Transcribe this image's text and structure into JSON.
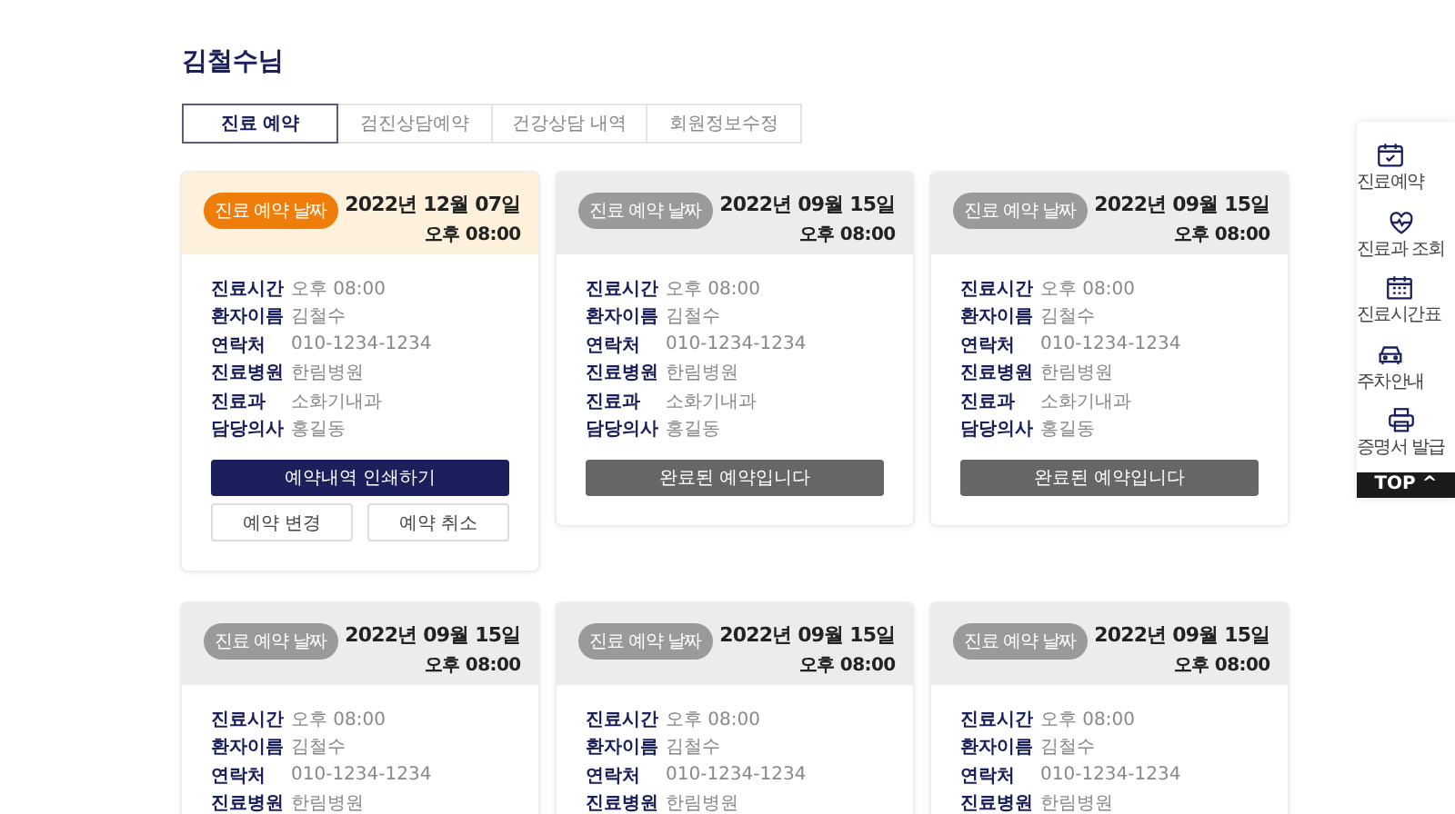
{
  "page_title": "김철수님",
  "tabs": [
    {
      "label": "진료 예약",
      "selected": true
    },
    {
      "label": "검진상담예약",
      "selected": false
    },
    {
      "label": "건강상담 내역",
      "selected": false
    },
    {
      "label": "회원정보수정",
      "selected": false
    }
  ],
  "cards": [
    {
      "completed": false,
      "badge": "진료 예약 날짜",
      "date": "2022년 12월 07일",
      "time": "오후 08:00",
      "fields": [
        {
          "label": "진료시간",
          "value": "오후 08:00"
        },
        {
          "label": "환자이름",
          "value": "김철수"
        },
        {
          "label": "연락처",
          "value": "010-1234-1234"
        },
        {
          "label": "진료병원",
          "value": "한림병원"
        },
        {
          "label": "진료과",
          "value": "소화기내과"
        },
        {
          "label": "담당의사",
          "value": "홍길동"
        }
      ],
      "buttons": [
        {
          "kind": "primary",
          "label": "예약내역 인쇄하기"
        },
        {
          "kind": "outline",
          "label": "예약 변경"
        },
        {
          "kind": "outline",
          "label": "예약 취소"
        }
      ]
    },
    {
      "completed": true,
      "badge": "진료 예약 날짜",
      "date": "2022년 09월 15일",
      "time": "오후 08:00",
      "fields": [
        {
          "label": "진료시간",
          "value": "오후 08:00"
        },
        {
          "label": "환자이름",
          "value": "김철수"
        },
        {
          "label": "연락처",
          "value": "010-1234-1234"
        },
        {
          "label": "진료병원",
          "value": "한림병원"
        },
        {
          "label": "진료과",
          "value": "소화기내과"
        },
        {
          "label": "담당의사",
          "value": "홍길동"
        }
      ],
      "buttons": [
        {
          "kind": "done",
          "label": "완료된 예약입니다"
        }
      ]
    },
    {
      "completed": true,
      "badge": "진료 예약 날짜",
      "date": "2022년 09월 15일",
      "time": "오후 08:00",
      "fields": [
        {
          "label": "진료시간",
          "value": "오후 08:00"
        },
        {
          "label": "환자이름",
          "value": "김철수"
        },
        {
          "label": "연락처",
          "value": "010-1234-1234"
        },
        {
          "label": "진료병원",
          "value": "한림병원"
        },
        {
          "label": "진료과",
          "value": "소화기내과"
        },
        {
          "label": "담당의사",
          "value": "홍길동"
        }
      ],
      "buttons": [
        {
          "kind": "done",
          "label": "완료된 예약입니다"
        }
      ]
    },
    {
      "completed": true,
      "badge": "진료 예약 날짜",
      "date": "2022년 09월 15일",
      "time": "오후 08:00",
      "fields": [
        {
          "label": "진료시간",
          "value": "오후 08:00"
        },
        {
          "label": "환자이름",
          "value": "김철수"
        },
        {
          "label": "연락처",
          "value": "010-1234-1234"
        },
        {
          "label": "진료병원",
          "value": "한림병원"
        }
      ]
    },
    {
      "completed": true,
      "badge": "진료 예약 날짜",
      "date": "2022년 09월 15일",
      "time": "오후 08:00",
      "fields": [
        {
          "label": "진료시간",
          "value": "오후 08:00"
        },
        {
          "label": "환자이름",
          "value": "김철수"
        },
        {
          "label": "연락처",
          "value": "010-1234-1234"
        },
        {
          "label": "진료병원",
          "value": "한림병원"
        }
      ]
    },
    {
      "completed": true,
      "badge": "진료 예약 날짜",
      "date": "2022년 09월 15일",
      "time": "오후 08:00",
      "fields": [
        {
          "label": "진료시간",
          "value": "오후 08:00"
        },
        {
          "label": "환자이름",
          "value": "김철수"
        },
        {
          "label": "연락처",
          "value": "010-1234-1234"
        },
        {
          "label": "진료병원",
          "value": "한림병원"
        }
      ]
    }
  ],
  "quick_menu": {
    "items": [
      {
        "label": "진료예약"
      },
      {
        "label": "진료과 조회"
      },
      {
        "label": "진료시간표"
      },
      {
        "label": "주차안내"
      },
      {
        "label": "증명서 발급"
      }
    ],
    "top_button": "TOP ^"
  }
}
